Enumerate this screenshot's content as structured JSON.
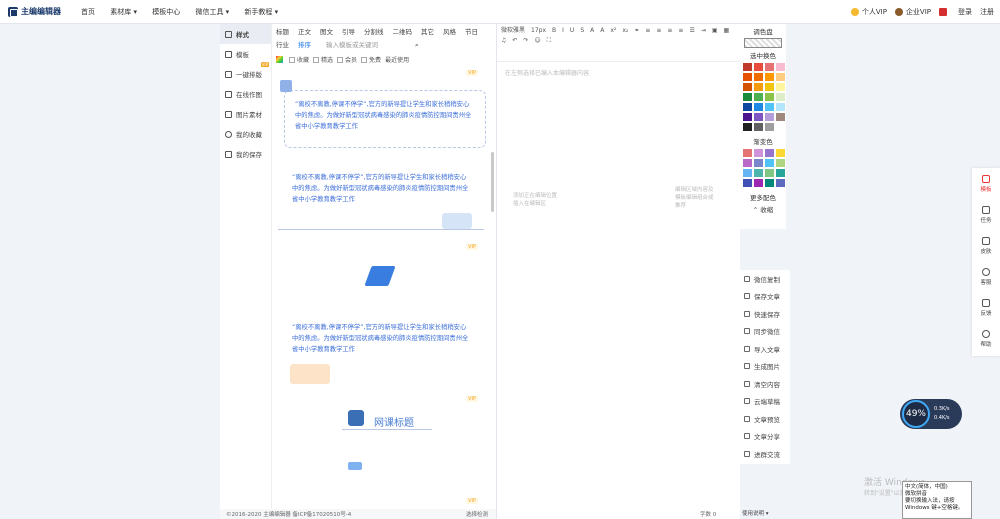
{
  "app": {
    "logo": "主编编辑器"
  },
  "nav": [
    "首页",
    "素材库 ▾",
    "模板中心",
    "微信工具 ▾",
    "新手教程 ▾"
  ],
  "topright": {
    "vip": "个人VIP",
    "evip": "企业VIP",
    "login": "登录",
    "register": "注册"
  },
  "left": {
    "items": [
      {
        "label": "样式"
      },
      {
        "label": "模板"
      },
      {
        "label": "一键排版"
      },
      {
        "label": "在线作图"
      },
      {
        "label": "图片素材"
      },
      {
        "label": "我的收藏"
      },
      {
        "label": "我的保存"
      }
    ]
  },
  "mat": {
    "tabs": [
      "标题",
      "正文",
      "图文",
      "引导",
      "分割线",
      "二维码",
      "其它",
      "风格"
    ],
    "tabs2": [
      "节日",
      "行业",
      "排序"
    ],
    "search_placeholder": "输入模板或关键词",
    "filters": [
      "收藏",
      "精选",
      "会员",
      "免费",
      "最近使用"
    ],
    "card_text": "“离校不离教,停课不停学”,官方的新导提让学生和家长稍稍安心中的焦虑。为做好新型冠状病毒感染的肺炎疫情防控期间贵州全省中小学教育教学工作",
    "card_title": "网课标题",
    "vip": "VIP"
  },
  "footer": "©2016-2020 主编编辑器 备ICP备17020510号-4",
  "footer_right": "选择检测",
  "editor": {
    "font": "微软雅黑",
    "size": "17px",
    "placeholder": "在左侧选择已编入本编辑器内容",
    "ph2": "添加正在编辑位置\n插入在编辑区",
    "ph3": "编辑区域内容及\n模板编辑组合或\n推荐",
    "wordcount": "字数 0",
    "bottom": "使用说明 ▾"
  },
  "palette": {
    "title": "调色盘",
    "choose": "选中换色",
    "gradient": "渐变色",
    "more": "更多配色",
    "fold": "收缩",
    "colors": [
      "#c0392b",
      "#e74c3c",
      "#e57373",
      "#f8bbd0",
      "#e65100",
      "#ef6c00",
      "#ff9800",
      "#ffcc80",
      "#d35400",
      "#f39c12",
      "#f1c40f",
      "#fff59d",
      "#1b8a3a",
      "#4caf50",
      "#8bc34a",
      "#dcedc8",
      "#0d47a1",
      "#1e88e5",
      "#4fc3f7",
      "#b3e5fc",
      "#4a148c",
      "#7e57c2",
      "#b39ddb",
      "#a1887f",
      "#212121",
      "#616161",
      "#9e9e9e",
      "#ffffff"
    ],
    "grad": [
      "#e57373",
      "#ce93d8",
      "#9575cd",
      "#fdd835",
      "#ba68c8",
      "#7986cb",
      "#4fc3f7",
      "#aed581",
      "#64b5f6",
      "#4db6ac",
      "#81c784",
      "#26a69a",
      "#3f51b5",
      "#9c27b0",
      "#00897b",
      "#5c6bc0"
    ]
  },
  "ops": [
    "微信复制",
    "保存文章",
    "快速保存",
    "同步微信",
    "导入文章",
    "生成图片",
    "清空内容",
    "云端草稿",
    "文章预览",
    "文章分享",
    "进群交流"
  ],
  "side": [
    "模板",
    "任务",
    "皮肤",
    "客服",
    "反馈",
    "帮助"
  ],
  "speed": {
    "val": "49%",
    "up": "0.3K/s",
    "down": "0.4K/s"
  },
  "win": {
    "a": "激活 Windows",
    "b": "转到\"设置\"以激活 Windows。"
  },
  "ime": {
    "l1": "中文(简体，中国)",
    "l2": "微软拼音",
    "l3": "要切换输入法，请按",
    "l4": "Windows 键+空格键。"
  }
}
